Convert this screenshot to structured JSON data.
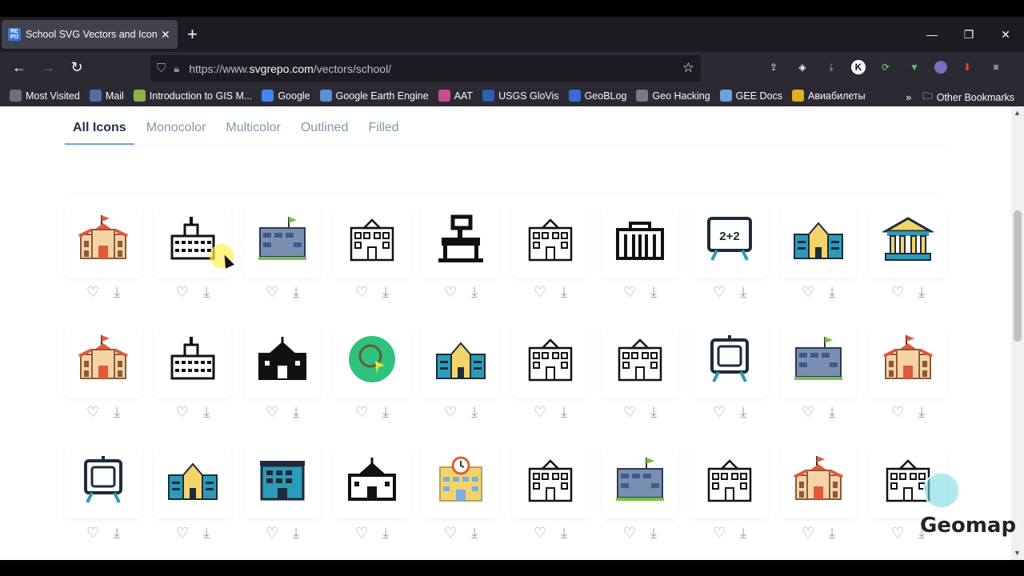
{
  "browser": {
    "tab_title": "School SVG Vectors and Icons -",
    "tab_favicon_text": "RE PO",
    "url_prefix": "https://www.",
    "url_domain": "svgrepo.com",
    "url_path": "/vectors/school/"
  },
  "bookmarks": [
    {
      "label": "Most Visited",
      "icon": "gear-icon",
      "color": "#6e6e7a"
    },
    {
      "label": "Mail",
      "icon": "mail-icon",
      "color": "#4a6fa5"
    },
    {
      "label": "Introduction to GIS M...",
      "icon": "image-icon",
      "color": "#8fb34a"
    },
    {
      "label": "Google",
      "icon": "google-icon",
      "color": "#4285f4"
    },
    {
      "label": "Google Earth Engine",
      "icon": "earth-engine-icon",
      "color": "#5c8fd6"
    },
    {
      "label": "AAT",
      "icon": "aat-icon",
      "color": "#c94c8c"
    },
    {
      "label": "USGS GloVis",
      "icon": "glovis-icon",
      "color": "#2f5fb5"
    },
    {
      "label": "GeoBLog",
      "icon": "geoblog-icon",
      "color": "#3a6bd4"
    },
    {
      "label": "Geo Hacking",
      "icon": "globe-icon",
      "color": "#7a7a86"
    },
    {
      "label": "GEE Docs",
      "icon": "docs-icon",
      "color": "#6aa0e0"
    },
    {
      "label": "Авиабилеты",
      "icon": "plane-icon",
      "color": "#e0b020"
    }
  ],
  "other_bookmarks": "Other Bookmarks",
  "filter_tabs": [
    {
      "label": "All Icons",
      "active": true
    },
    {
      "label": "Monocolor",
      "active": false
    },
    {
      "label": "Multicolor",
      "active": false
    },
    {
      "label": "Outlined",
      "active": false
    },
    {
      "label": "Filled",
      "active": false
    }
  ],
  "icons": [
    [
      "school-flag-orange-icon",
      "school-black-tower-icon",
      "school-blue-flag-icon",
      "building-outline-icon",
      "desk-lamp-icon",
      "school-classic-outline-icon",
      "columns-building-icon",
      "chalkboard-2plus2-icon",
      "school-blue-yellow-icon",
      "bank-columns-icon"
    ],
    [
      "school-flag-orange-icon",
      "school-black-tower-icon",
      "school-bell-black-icon",
      "green-circle-cursor-icon",
      "school-blue-yellow-icon",
      "tall-building-outline-icon",
      "tall-building-outline-icon",
      "easel-board-icon",
      "school-navy-icon",
      "school-red-clock-icon"
    ],
    [
      "easel-board-icon",
      "school-blue-yellow-icon",
      "office-blue-icon",
      "school-arch-black-icon",
      "school-clock-yellow-icon",
      "school-flag-outline-icon",
      "school-blue-flag-icon",
      "school-house-outline-icon",
      "school-flag-orange-icon",
      "school-bell-outline-icon"
    ]
  ],
  "watermark": "Geomap",
  "colors": {
    "accent": "#7aa4d3",
    "tab_active": "#22324a",
    "tab_inactive": "#8795a8",
    "chrome_bg": "#2b2a33"
  }
}
